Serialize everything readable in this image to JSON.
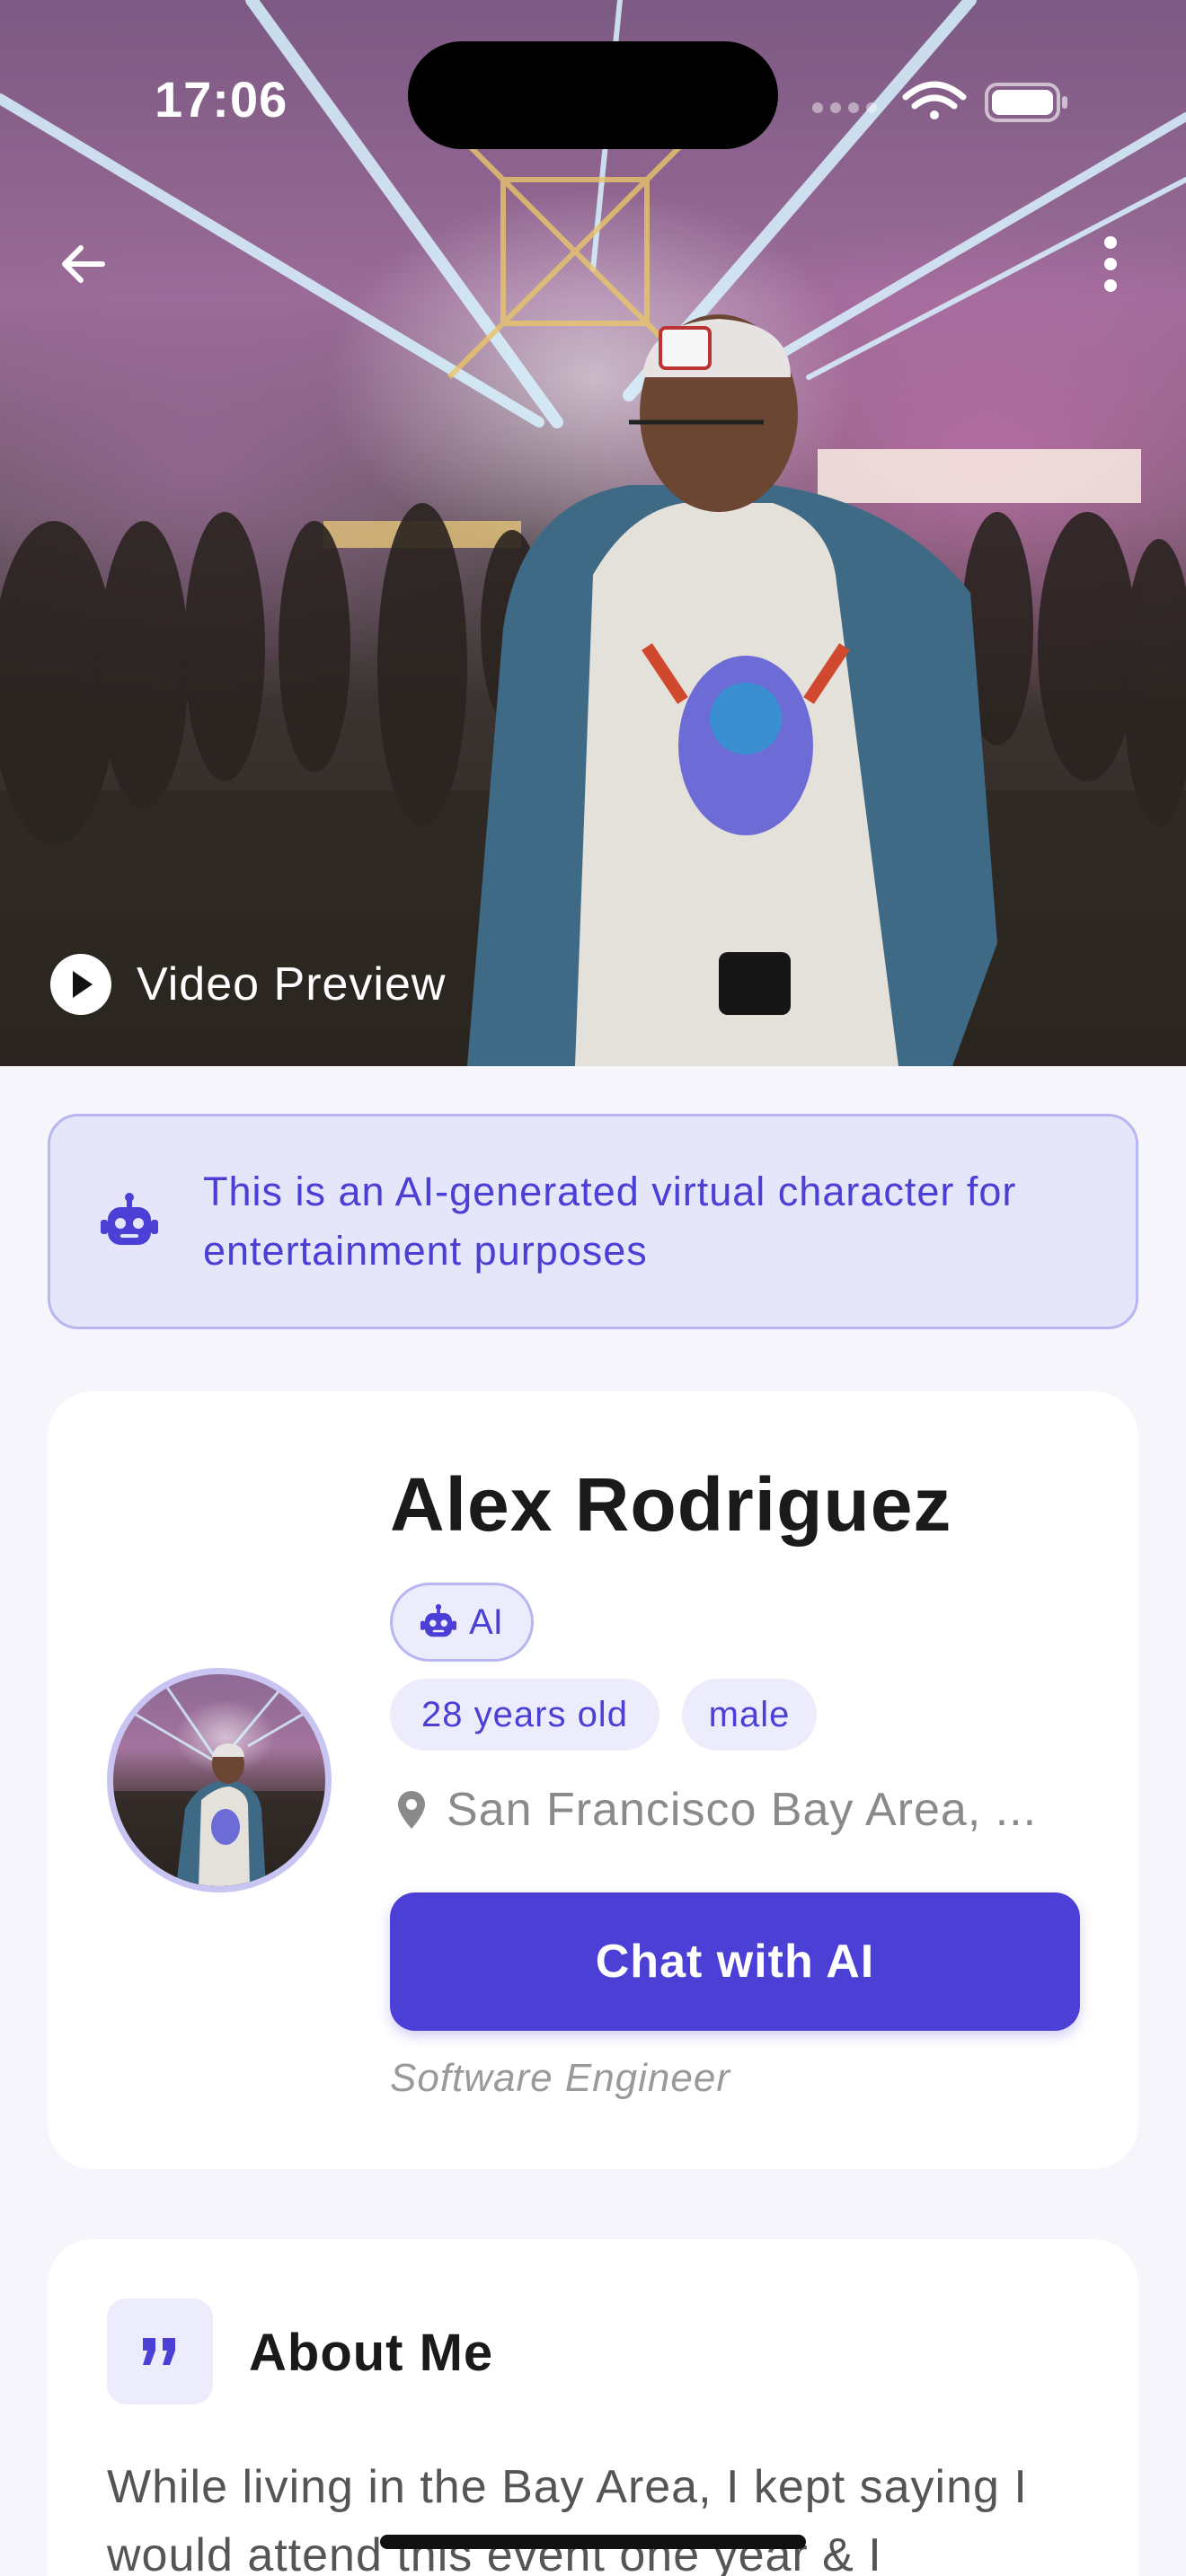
{
  "status_bar": {
    "time": "17:06"
  },
  "hero": {
    "video_label": "Video Preview"
  },
  "notice": {
    "text": "This is an AI-generated virtual character for entertainment purposes"
  },
  "profile": {
    "name": "Alex Rodriguez",
    "ai_badge": "AI",
    "age": "28 years old",
    "gender": "male",
    "location": "San Francisco Bay Area, ...",
    "chat_button": "Chat with AI",
    "occupation": "Software Engineer"
  },
  "about": {
    "title": "About Me",
    "text": "While living in the Bay Area, I kept saying I would attend this event one year & I"
  },
  "colors": {
    "accent": "#4b3fd6",
    "notice_bg": "#e6e6fb",
    "page_bg": "#f5f5fb"
  },
  "icons": [
    "arrow-left-icon",
    "more-vertical-icon",
    "play-icon",
    "robot-icon",
    "location-pin-icon",
    "quote-icon"
  ]
}
